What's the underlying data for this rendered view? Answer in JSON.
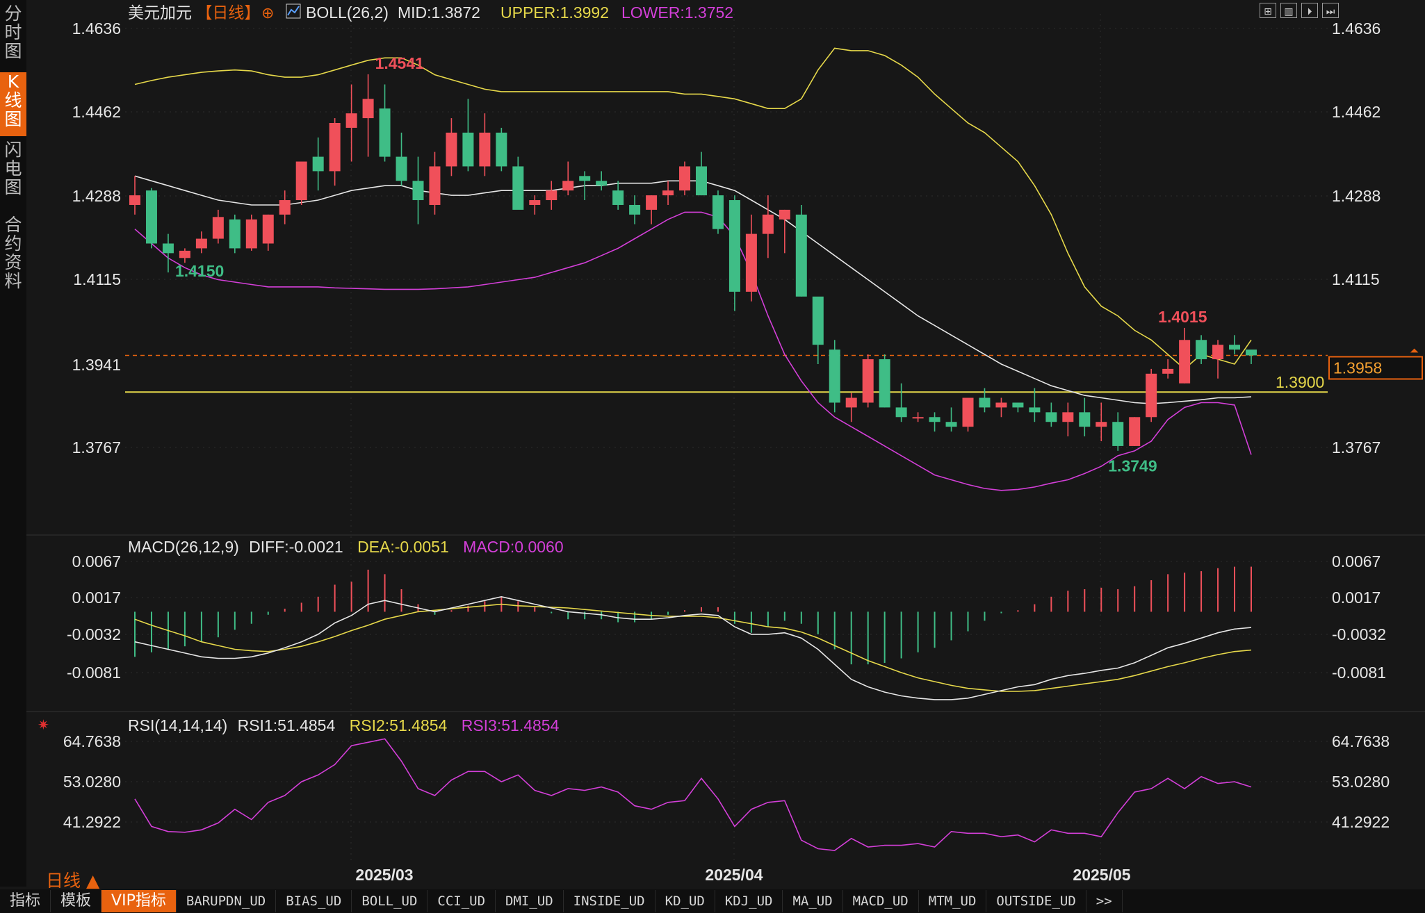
{
  "sidebar": {
    "tabs": [
      {
        "label": "分时图",
        "active": false
      },
      {
        "label": "K线图",
        "active": true
      },
      {
        "label": "闪电图",
        "active": false
      },
      {
        "label": "合约资料",
        "active": false
      }
    ]
  },
  "header": {
    "symbol": "美元加元",
    "period_tag": "【日线】",
    "indicator": "BOLL(26,2)",
    "mid": "MID:1.3872",
    "upper": "UPPER:1.3992",
    "lower": "LOWER:1.3752",
    "toolbar_icons": [
      "layout-grid-icon",
      "columns-icon",
      "play-step-icon",
      "forward-icon"
    ]
  },
  "colors": {
    "background": "#171717",
    "up": "#f0505a",
    "down": "#3fbd86",
    "mid_line": "#e6e6e6",
    "upper_line": "#e6d84a",
    "lower_line": "#d33fd8",
    "accent": "#e8620f"
  },
  "chart_data": [
    {
      "type": "candlestick",
      "title": "美元加元【日线】 BOLL(26,2)",
      "y_ticks": [
        "1.4636",
        "1.4462",
        "1.4288",
        "1.4115",
        "1.3941",
        "1.3767"
      ],
      "ylim": [
        1.366,
        1.466
      ],
      "x_ticks": [
        "2025/03",
        "2025/04",
        "2025/05"
      ],
      "x_tick_index": [
        13,
        35,
        58
      ],
      "candles": [
        [
          1.427,
          1.433,
          1.425,
          1.429
        ],
        [
          1.43,
          1.4305,
          1.418,
          1.419
        ],
        [
          1.419,
          1.421,
          1.413,
          1.417
        ],
        [
          1.416,
          1.418,
          1.415,
          1.4175
        ],
        [
          1.418,
          1.4215,
          1.417,
          1.42
        ],
        [
          1.42,
          1.426,
          1.419,
          1.4245
        ],
        [
          1.424,
          1.425,
          1.417,
          1.418
        ],
        [
          1.418,
          1.425,
          1.4175,
          1.424
        ],
        [
          1.419,
          1.425,
          1.4175,
          1.425
        ],
        [
          1.425,
          1.43,
          1.423,
          1.428
        ],
        [
          1.428,
          1.435,
          1.427,
          1.436
        ],
        [
          1.437,
          1.441,
          1.43,
          1.434
        ],
        [
          1.434,
          1.445,
          1.431,
          1.444
        ],
        [
          1.443,
          1.452,
          1.436,
          1.446
        ],
        [
          1.445,
          1.4541,
          1.437,
          1.449
        ],
        [
          1.447,
          1.452,
          1.436,
          1.437
        ],
        [
          1.437,
          1.442,
          1.431,
          1.432
        ],
        [
          1.432,
          1.437,
          1.423,
          1.428
        ],
        [
          1.427,
          1.438,
          1.425,
          1.435
        ],
        [
          1.435,
          1.445,
          1.433,
          1.442
        ],
        [
          1.442,
          1.449,
          1.434,
          1.435
        ],
        [
          1.435,
          1.446,
          1.433,
          1.442
        ],
        [
          1.442,
          1.443,
          1.434,
          1.435
        ],
        [
          1.435,
          1.437,
          1.427,
          1.426
        ],
        [
          1.427,
          1.429,
          1.425,
          1.428
        ],
        [
          1.428,
          1.432,
          1.426,
          1.43
        ],
        [
          1.43,
          1.436,
          1.429,
          1.432
        ],
        [
          1.433,
          1.434,
          1.428,
          1.432
        ],
        [
          1.432,
          1.434,
          1.43,
          1.431
        ],
        [
          1.43,
          1.432,
          1.426,
          1.427
        ],
        [
          1.427,
          1.429,
          1.423,
          1.425
        ],
        [
          1.426,
          1.429,
          1.423,
          1.429
        ],
        [
          1.429,
          1.432,
          1.427,
          1.43
        ],
        [
          1.43,
          1.436,
          1.429,
          1.435
        ],
        [
          1.435,
          1.438,
          1.429,
          1.429
        ],
        [
          1.429,
          1.43,
          1.421,
          1.422
        ],
        [
          1.428,
          1.429,
          1.405,
          1.409
        ],
        [
          1.409,
          1.425,
          1.407,
          1.421
        ],
        [
          1.421,
          1.429,
          1.416,
          1.425
        ],
        [
          1.424,
          1.426,
          1.417,
          1.426
        ],
        [
          1.425,
          1.427,
          1.408,
          1.408
        ],
        [
          1.408,
          1.405,
          1.394,
          1.398
        ],
        [
          1.397,
          1.399,
          1.384,
          1.386
        ],
        [
          1.385,
          1.388,
          1.382,
          1.387
        ],
        [
          1.386,
          1.396,
          1.385,
          1.395
        ],
        [
          1.395,
          1.396,
          1.385,
          1.385
        ],
        [
          1.385,
          1.39,
          1.382,
          1.383
        ],
        [
          1.383,
          1.384,
          1.382,
          1.383
        ],
        [
          1.383,
          1.384,
          1.38,
          1.382
        ],
        [
          1.382,
          1.385,
          1.38,
          1.381
        ],
        [
          1.381,
          1.386,
          1.38,
          1.387
        ],
        [
          1.387,
          1.389,
          1.384,
          1.385
        ],
        [
          1.385,
          1.387,
          1.383,
          1.386
        ],
        [
          1.386,
          1.386,
          1.384,
          1.385
        ],
        [
          1.385,
          1.389,
          1.382,
          1.384
        ],
        [
          1.384,
          1.386,
          1.381,
          1.382
        ],
        [
          1.382,
          1.386,
          1.379,
          1.384
        ],
        [
          1.384,
          1.387,
          1.379,
          1.381
        ],
        [
          1.381,
          1.386,
          1.378,
          1.382
        ],
        [
          1.382,
          1.384,
          1.376,
          1.377
        ],
        [
          1.377,
          1.383,
          1.377,
          1.383
        ],
        [
          1.383,
          1.393,
          1.382,
          1.392
        ],
        [
          1.392,
          1.395,
          1.391,
          1.393
        ],
        [
          1.39,
          1.4015,
          1.39,
          1.399
        ],
        [
          1.399,
          1.4,
          1.394,
          1.395
        ],
        [
          1.395,
          1.399,
          1.391,
          1.398
        ],
        [
          1.398,
          1.4,
          1.396,
          1.397
        ],
        [
          1.397,
          1.396,
          1.394,
          1.3958
        ]
      ],
      "upper": [
        1.452,
        1.4528,
        1.4535,
        1.454,
        1.4545,
        1.4548,
        1.455,
        1.4548,
        1.454,
        1.4535,
        1.4535,
        1.454,
        1.455,
        1.456,
        1.457,
        1.4575,
        1.4575,
        1.456,
        1.454,
        1.453,
        1.452,
        1.451,
        1.4505,
        1.4505,
        1.4505,
        1.4505,
        1.4505,
        1.4505,
        1.4505,
        1.4505,
        1.4505,
        1.4505,
        1.4505,
        1.45,
        1.45,
        1.4495,
        1.449,
        1.448,
        1.447,
        1.447,
        1.449,
        1.455,
        1.4595,
        1.459,
        1.459,
        1.458,
        1.456,
        1.4535,
        1.45,
        1.447,
        1.444,
        1.442,
        1.439,
        1.436,
        1.431,
        1.425,
        1.417,
        1.41,
        1.406,
        1.404,
        1.401,
        1.399,
        1.396,
        1.393,
        1.396,
        1.395,
        1.394,
        1.399
      ],
      "mid": [
        1.433,
        1.432,
        1.431,
        1.43,
        1.429,
        1.428,
        1.4275,
        1.427,
        1.427,
        1.427,
        1.4275,
        1.428,
        1.429,
        1.43,
        1.4305,
        1.431,
        1.431,
        1.43,
        1.4295,
        1.429,
        1.429,
        1.4295,
        1.43,
        1.43,
        1.43,
        1.43,
        1.4305,
        1.431,
        1.431,
        1.4315,
        1.4315,
        1.4315,
        1.432,
        1.432,
        1.432,
        1.431,
        1.43,
        1.428,
        1.426,
        1.424,
        1.4215,
        1.419,
        1.4165,
        1.414,
        1.4115,
        1.409,
        1.4065,
        1.404,
        1.402,
        1.4,
        1.398,
        1.396,
        1.394,
        1.3925,
        1.391,
        1.3895,
        1.3885,
        1.3875,
        1.387,
        1.3865,
        1.386,
        1.3858,
        1.386,
        1.3863,
        1.3866,
        1.387,
        1.387,
        1.3872
      ],
      "lower": [
        1.422,
        1.419,
        1.416,
        1.414,
        1.4125,
        1.4115,
        1.411,
        1.4105,
        1.41,
        1.41,
        1.41,
        1.41,
        1.4098,
        1.4097,
        1.4096,
        1.4095,
        1.4095,
        1.4095,
        1.4096,
        1.4098,
        1.41,
        1.4105,
        1.411,
        1.4115,
        1.412,
        1.413,
        1.414,
        1.415,
        1.4165,
        1.418,
        1.42,
        1.422,
        1.424,
        1.4255,
        1.4255,
        1.4245,
        1.4205,
        1.413,
        1.404,
        1.396,
        1.3905,
        1.386,
        1.383,
        1.381,
        1.379,
        1.377,
        1.375,
        1.373,
        1.371,
        1.37,
        1.369,
        1.3682,
        1.3678,
        1.368,
        1.3685,
        1.3693,
        1.37,
        1.3713,
        1.3728,
        1.375,
        1.376,
        1.378,
        1.3825,
        1.385,
        1.386,
        1.386,
        1.3855,
        1.3752
      ],
      "marks": {
        "high": "1.4541",
        "low_start": "1.4150",
        "recent_high": "1.4015",
        "recent_low": "1.3749"
      },
      "horizontal_line_label": "1.3900",
      "horizontal_line_value": 1.3882,
      "current_price_label": "1.3958",
      "current_price_value": 1.3958
    },
    {
      "type": "macd",
      "title": "MACD(26,12,9)",
      "diff_label": "DIFF:-0.0021",
      "dea_label": "DEA:-0.0051",
      "macd_label": "MACD:0.0060",
      "y_ticks": [
        "0.0067",
        "0.0017",
        "-0.0032",
        "-0.0081"
      ],
      "ylim": [
        -0.013,
        0.0078
      ],
      "diff": [
        -0.004,
        -0.0045,
        -0.005,
        -0.0055,
        -0.006,
        -0.0062,
        -0.0062,
        -0.006,
        -0.0055,
        -0.0048,
        -0.004,
        -0.003,
        -0.0015,
        -0.0005,
        0.001,
        0.0015,
        0.001,
        0.0005,
        0.0,
        0.0005,
        0.001,
        0.0015,
        0.002,
        0.0015,
        0.001,
        0.0005,
        0.0,
        -0.0002,
        -0.0004,
        -0.0008,
        -0.001,
        -0.001,
        -0.0008,
        -0.0005,
        -0.0003,
        -0.0005,
        -0.002,
        -0.003,
        -0.003,
        -0.0028,
        -0.0035,
        -0.005,
        -0.007,
        -0.009,
        -0.01,
        -0.0107,
        -0.0112,
        -0.0115,
        -0.0117,
        -0.0117,
        -0.0115,
        -0.011,
        -0.0105,
        -0.01,
        -0.0097,
        -0.009,
        -0.0085,
        -0.0082,
        -0.0078,
        -0.0075,
        -0.0068,
        -0.0058,
        -0.0048,
        -0.0042,
        -0.0035,
        -0.0028,
        -0.0023,
        -0.0021
      ],
      "dea": [
        -0.001,
        -0.0018,
        -0.0025,
        -0.0032,
        -0.004,
        -0.0045,
        -0.005,
        -0.0052,
        -0.0053,
        -0.005,
        -0.0046,
        -0.004,
        -0.0033,
        -0.0025,
        -0.0018,
        -0.001,
        -0.0005,
        0.0,
        0.0002,
        0.0004,
        0.0006,
        0.0008,
        0.001,
        0.0008,
        0.0007,
        0.0006,
        0.0005,
        0.0003,
        0.0001,
        -0.0001,
        -0.0003,
        -0.0005,
        -0.0006,
        -0.0006,
        -0.0006,
        -0.0008,
        -0.0012,
        -0.0016,
        -0.002,
        -0.0022,
        -0.0027,
        -0.0035,
        -0.0045,
        -0.0055,
        -0.0065,
        -0.0073,
        -0.0081,
        -0.0088,
        -0.0093,
        -0.0098,
        -0.0102,
        -0.0104,
        -0.0106,
        -0.0106,
        -0.0105,
        -0.0102,
        -0.0099,
        -0.0096,
        -0.0093,
        -0.009,
        -0.0085,
        -0.0079,
        -0.0073,
        -0.0068,
        -0.0062,
        -0.0057,
        -0.0053,
        -0.0051
      ],
      "hist": [
        -0.006,
        -0.0054,
        -0.005,
        -0.0046,
        -0.004,
        -0.0034,
        -0.0024,
        -0.0016,
        -0.0004,
        0.0004,
        0.0012,
        0.002,
        0.0036,
        0.004,
        0.0056,
        0.005,
        0.003,
        0.001,
        -0.0004,
        0.0002,
        0.0008,
        0.0014,
        0.002,
        0.0014,
        0.0006,
        -0.0002,
        -0.001,
        -0.001,
        -0.001,
        -0.0014,
        -0.0014,
        -0.001,
        -0.0004,
        0.0002,
        0.0006,
        0.0006,
        -0.0016,
        -0.0028,
        -0.002,
        -0.0012,
        -0.0016,
        -0.003,
        -0.005,
        -0.007,
        -0.007,
        -0.0068,
        -0.0062,
        -0.0054,
        -0.0048,
        -0.0038,
        -0.0026,
        -0.0012,
        -0.0002,
        0.0002,
        0.001,
        0.002,
        0.0028,
        0.003,
        0.0032,
        0.003,
        0.0034,
        0.0042,
        0.005,
        0.0052,
        0.0054,
        0.0058,
        0.006,
        0.006
      ]
    },
    {
      "type": "line",
      "title": "RSI(14,14,14)",
      "rsi1_label": "RSI1:51.4854",
      "rsi2_label": "RSI2:51.4854",
      "rsi3_label": "RSI3:51.4854",
      "y_ticks": [
        "64.7638",
        "53.0280",
        "41.2922"
      ],
      "ylim": [
        30.0,
        68.0
      ],
      "rsi": [
        48.0,
        40.0,
        38.5,
        38.3,
        39.0,
        41.0,
        45.0,
        42.0,
        47.0,
        49.0,
        53.0,
        55.0,
        58.0,
        63.5,
        64.5,
        65.5,
        59.0,
        51.0,
        49.0,
        53.5,
        56.0,
        56.0,
        53.0,
        55.0,
        50.5,
        49.0,
        51.0,
        50.5,
        51.5,
        50.0,
        46.0,
        45.0,
        47.0,
        47.5,
        54.0,
        48.0,
        40.0,
        45.0,
        47.0,
        47.5,
        36.0,
        33.5,
        33.0,
        36.5,
        34.0,
        34.5,
        34.5,
        35.0,
        34.0,
        38.5,
        38.0,
        38.0,
        37.0,
        37.5,
        35.5,
        39.0,
        38.0,
        38.0,
        37.0,
        44.0,
        50.0,
        51.0,
        54.0,
        51.0,
        54.5,
        52.5,
        53.0,
        51.5
      ]
    }
  ],
  "period_label": "日线",
  "bottom_tabs": [
    {
      "label": "指标",
      "active": false
    },
    {
      "label": "模板",
      "active": false
    },
    {
      "label": "VIP指标",
      "active": true
    },
    {
      "label": "BARUPDN_UD",
      "active": false
    },
    {
      "label": "BIAS_UD",
      "active": false
    },
    {
      "label": "BOLL_UD",
      "active": false
    },
    {
      "label": "CCI_UD",
      "active": false
    },
    {
      "label": "DMI_UD",
      "active": false
    },
    {
      "label": "INSIDE_UD",
      "active": false
    },
    {
      "label": "KD_UD",
      "active": false
    },
    {
      "label": "KDJ_UD",
      "active": false
    },
    {
      "label": "MA_UD",
      "active": false
    },
    {
      "label": "MACD_UD",
      "active": false
    },
    {
      "label": "MTM_UD",
      "active": false
    },
    {
      "label": "OUTSIDE_UD",
      "active": false
    },
    {
      "label": ">>",
      "active": false
    }
  ]
}
